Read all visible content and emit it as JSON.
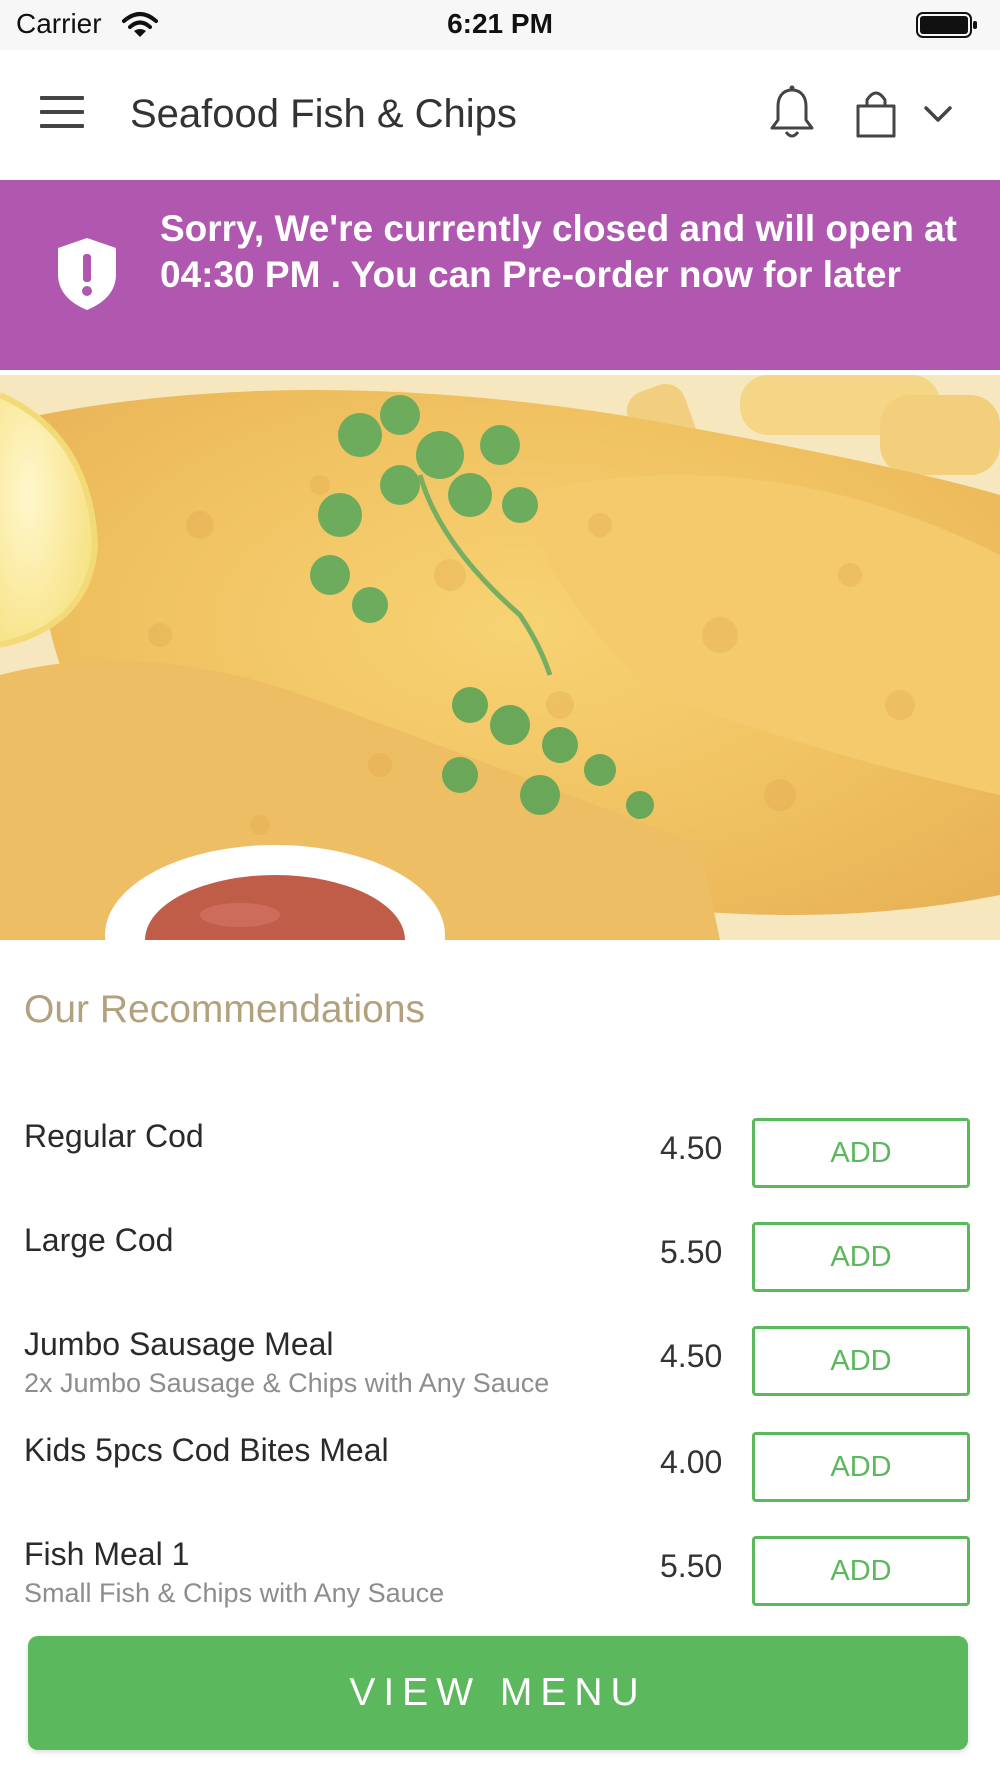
{
  "status_bar": {
    "carrier": "Carrier",
    "time": "6:21 PM",
    "wifi_icon": "wifi-icon",
    "battery_icon": "battery-icon"
  },
  "header": {
    "title": "Seafood Fish & Chips",
    "menu_icon": "hamburger-menu-icon",
    "notifications_icon": "bell-icon",
    "cart_icon": "shopping-bag-icon",
    "more_icon": "chevron-down-icon"
  },
  "banner": {
    "icon": "shield-alert-icon",
    "message": "Sorry, We're currently closed and will open at 04:30 PM . You can Pre-order now for later",
    "color": "#b057b0"
  },
  "hero": {
    "image": "fish-and-chips-photo"
  },
  "recommendations": {
    "title": "Our Recommendations",
    "items": [
      {
        "name": "Regular Cod",
        "description": "",
        "price": "4.50",
        "button": "ADD"
      },
      {
        "name": "Large Cod",
        "description": "",
        "price": "5.50",
        "button": "ADD"
      },
      {
        "name": "Jumbo Sausage Meal",
        "description": "2x Jumbo Sausage & Chips with Any Sauce",
        "price": "4.50",
        "button": "ADD"
      },
      {
        "name": "Kids 5pcs Cod Bites Meal",
        "description": "",
        "price": "4.00",
        "button": "ADD"
      },
      {
        "name": "Fish Meal 1",
        "description": "Small Fish & Chips with Any Sauce",
        "price": "5.50",
        "button": "ADD"
      }
    ]
  },
  "footer": {
    "view_menu_label": "VIEW MENU"
  },
  "colors": {
    "accent_green": "#5cb85c",
    "section_title": "#b3a07c"
  }
}
